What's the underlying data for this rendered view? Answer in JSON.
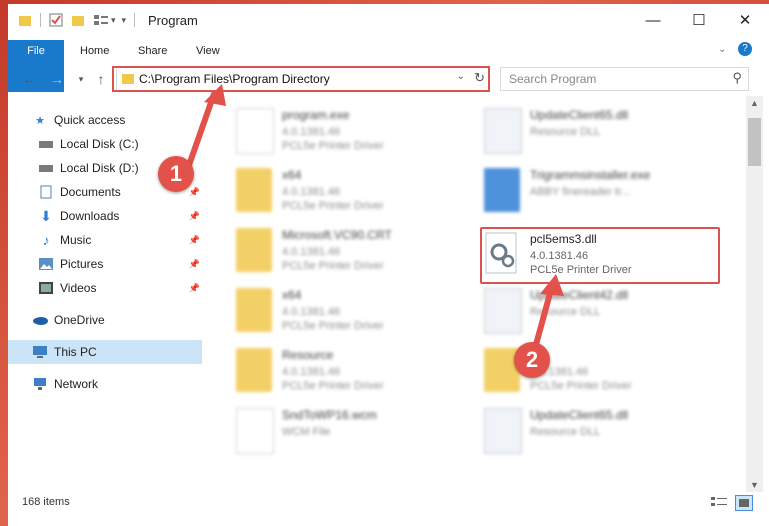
{
  "window": {
    "title": "Program",
    "controls": {
      "minimize": "—",
      "maximize": "☐",
      "close": "✕"
    }
  },
  "ribbon": {
    "tabs": [
      "File",
      "Home",
      "Share",
      "View"
    ]
  },
  "address": {
    "path": "C:\\Program Files\\Program Directory"
  },
  "search": {
    "placeholder": "Search Program"
  },
  "sidebar": {
    "items": [
      {
        "label": "Quick access",
        "icon": "star-icon",
        "pinned": false
      },
      {
        "label": "Local Disk (C:)",
        "icon": "drive-icon",
        "pinned": false
      },
      {
        "label": "Local Disk (D:)",
        "icon": "drive-icon",
        "pinned": false
      },
      {
        "label": "Documents",
        "icon": "document-icon",
        "pinned": true
      },
      {
        "label": "Downloads",
        "icon": "download-icon",
        "pinned": true
      },
      {
        "label": "Music",
        "icon": "music-icon",
        "pinned": true
      },
      {
        "label": "Pictures",
        "icon": "picture-icon",
        "pinned": true
      },
      {
        "label": "Videos",
        "icon": "video-icon",
        "pinned": true
      },
      {
        "label": "OneDrive",
        "icon": "cloud-icon",
        "pinned": false
      },
      {
        "label": "This PC",
        "icon": "computer-icon",
        "pinned": false,
        "active": true
      },
      {
        "label": "Network",
        "icon": "network-icon",
        "pinned": false
      }
    ]
  },
  "files": {
    "left": [
      {
        "name": "program.exe",
        "l1": "4.0.1381.46",
        "l2": "PCL5e Printer Driver",
        "type": "exe"
      },
      {
        "name": "x64",
        "l1": "4.0.1381.46",
        "l2": "PCL5e Printer Driver",
        "type": "folder"
      },
      {
        "name": "Microsoft.VC90.CRT",
        "l1": "4.0.1381.46",
        "l2": "PCL5e Printer Driver",
        "type": "folder"
      },
      {
        "name": "x64",
        "l1": "4.0.1381.46",
        "l2": "PCL5e Printer Driver",
        "type": "folder"
      },
      {
        "name": "Resource",
        "l1": "4.0.1381.46",
        "l2": "PCL5e Printer Driver",
        "type": "folder"
      },
      {
        "name": "SndToWP16.wcm",
        "l1": "WCM File",
        "l2": "",
        "type": "doc"
      }
    ],
    "right": [
      {
        "name": "UpdateClient65.dll",
        "l1": "Resource DLL",
        "l2": "",
        "type": "gear"
      },
      {
        "name": "Trigrammsinstaller.exe",
        "l1": "ABBY finereader tr...",
        "l2": "",
        "type": "exe"
      },
      {
        "name": "pcl5ems3.dll",
        "l1": "4.0.1381.46",
        "l2": "PCL5e Printer Driver",
        "type": "gear",
        "highlight": true
      },
      {
        "name": "UpdateClient42.dll",
        "l1": "Resource DLL",
        "l2": "",
        "type": "gear"
      },
      {
        "name": "",
        "l1": "4.0.1381.46",
        "l2": "PCL5e Printer Driver",
        "type": "folder"
      },
      {
        "name": "UpdateClient65.dll",
        "l1": "Resource DLL",
        "l2": "",
        "type": "gear"
      }
    ]
  },
  "status": {
    "items": "168 items"
  },
  "callouts": {
    "one": "1",
    "two": "2"
  },
  "colors": {
    "accent": "#1979ca",
    "highlight": "#d9534f",
    "callout": "#e2514a"
  }
}
